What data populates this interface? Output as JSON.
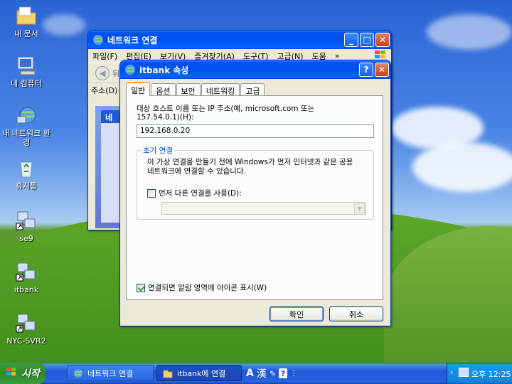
{
  "desktop": {
    "icons": [
      {
        "label": "내 문서"
      },
      {
        "label": "내 컴퓨터"
      },
      {
        "label": "내 네트워크 환경"
      },
      {
        "label": "휴지통"
      },
      {
        "label": "se9"
      },
      {
        "label": "itbank"
      },
      {
        "label": "NYC-SVR2"
      }
    ]
  },
  "bg_window": {
    "title": "네트워크 연결",
    "menu": [
      "파일(F)",
      "편집(E)",
      "보기(V)",
      "즐겨찾기(A)",
      "도구(T)",
      "고급(N)",
      "도움"
    ],
    "menu_more": "»",
    "back_label": "뒤",
    "address_label": "주소(D)",
    "side_header": "네"
  },
  "dialog": {
    "title": "itbank 속성",
    "help_btn": "?",
    "close_btn": "✕",
    "tabs": [
      "일반",
      "옵션",
      "보안",
      "네트워킹",
      "고급"
    ],
    "host_label": "대상 호스트 이름 또는 IP 주소(예, microsoft.com 또는 157.54.0.1)(H):",
    "host_value": "192.168.0.20",
    "group_title": "초기 연결",
    "group_desc": "이 가상 연결을 만들기 전에 Windows가 먼저 인터넷과 같은 공용 네트워크에 연결할 수 있습니다.",
    "dial_first_label": "먼저 다른 연결을 사용(D):",
    "dial_first_checked": false,
    "show_icon_label": "연결되면 알림 영역에 아이콘 표시(W)",
    "show_icon_checked": true,
    "ok_label": "확인",
    "cancel_label": "취소"
  },
  "taskbar": {
    "start_label": "시작",
    "tasks": [
      {
        "label": "네트워크 연결"
      },
      {
        "label": "itbank에 연결"
      }
    ],
    "ime_mode": "A",
    "ime_hanja": "漢",
    "clock": "오후 12:25"
  },
  "colors": {
    "titlebar": "#0053ee",
    "taskbar": "#2157d7",
    "start": "#2f8a2f",
    "group_title": "#0046d5"
  }
}
